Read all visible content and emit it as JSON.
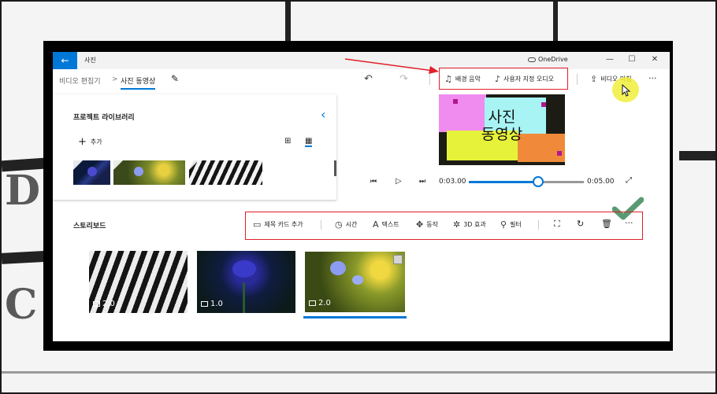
{
  "app": {
    "title": "사진",
    "cloud_label": "OneDrive",
    "back_icon": "arrow-left-icon",
    "window_controls": [
      "minimize-icon",
      "maximize-icon",
      "close-icon"
    ]
  },
  "breadcrumb": {
    "parent": "비디오 편집기",
    "separator": ">",
    "current": "사진 동영상"
  },
  "toolbar": {
    "music_label": "배경 음악",
    "custom_audio_label": "사용자 지정 오디오",
    "finish_label": "비디오 마침",
    "more": "···"
  },
  "library": {
    "title": "프로젝트 라이브러리",
    "add_label": "추가",
    "add_icon": "+"
  },
  "preview": {
    "title_line1": "사진",
    "title_line2": "동영상",
    "current_time": "0:03.00",
    "total_time": "0:05.00",
    "progress": 0.6
  },
  "storyboard": {
    "title": "스토리보드",
    "tools": {
      "title_card": "제목 카드 추가",
      "duration": "시간",
      "text": "텍스트",
      "motion": "동작",
      "effects_3d": "3D 효과",
      "filters": "필터",
      "more": "···"
    },
    "cards": [
      {
        "duration": "2.0",
        "subject": "zebra"
      },
      {
        "duration": "1.0",
        "subject": "iris"
      },
      {
        "duration": "2.0",
        "subject": "flower",
        "selected": true
      }
    ]
  },
  "colors": {
    "accent": "#0078d7",
    "annotation_red": "#e0202a",
    "check_green": "#5a9a72",
    "cursor_highlight": "#f0ee3a"
  }
}
